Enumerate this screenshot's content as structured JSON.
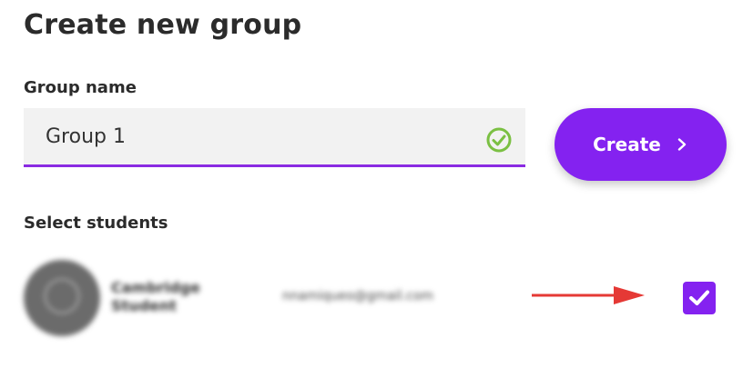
{
  "page": {
    "title": "Create new group"
  },
  "form": {
    "group_name_label": "Group name",
    "group_name_value": "Group 1",
    "create_button_label": "Create"
  },
  "students": {
    "section_label": "Select students",
    "items": [
      {
        "name": "Cambridge Student",
        "email": "nnamiqueo@gmail.com",
        "selected": true
      }
    ]
  },
  "icons": {
    "valid": "check-circle-icon",
    "create": "chevron-right-icon",
    "pointer": "red-arrow-icon",
    "selected": "checkmark-icon"
  },
  "colors": {
    "accent": "#8422f0",
    "valid": "#7bc043",
    "arrow": "#e53935"
  }
}
